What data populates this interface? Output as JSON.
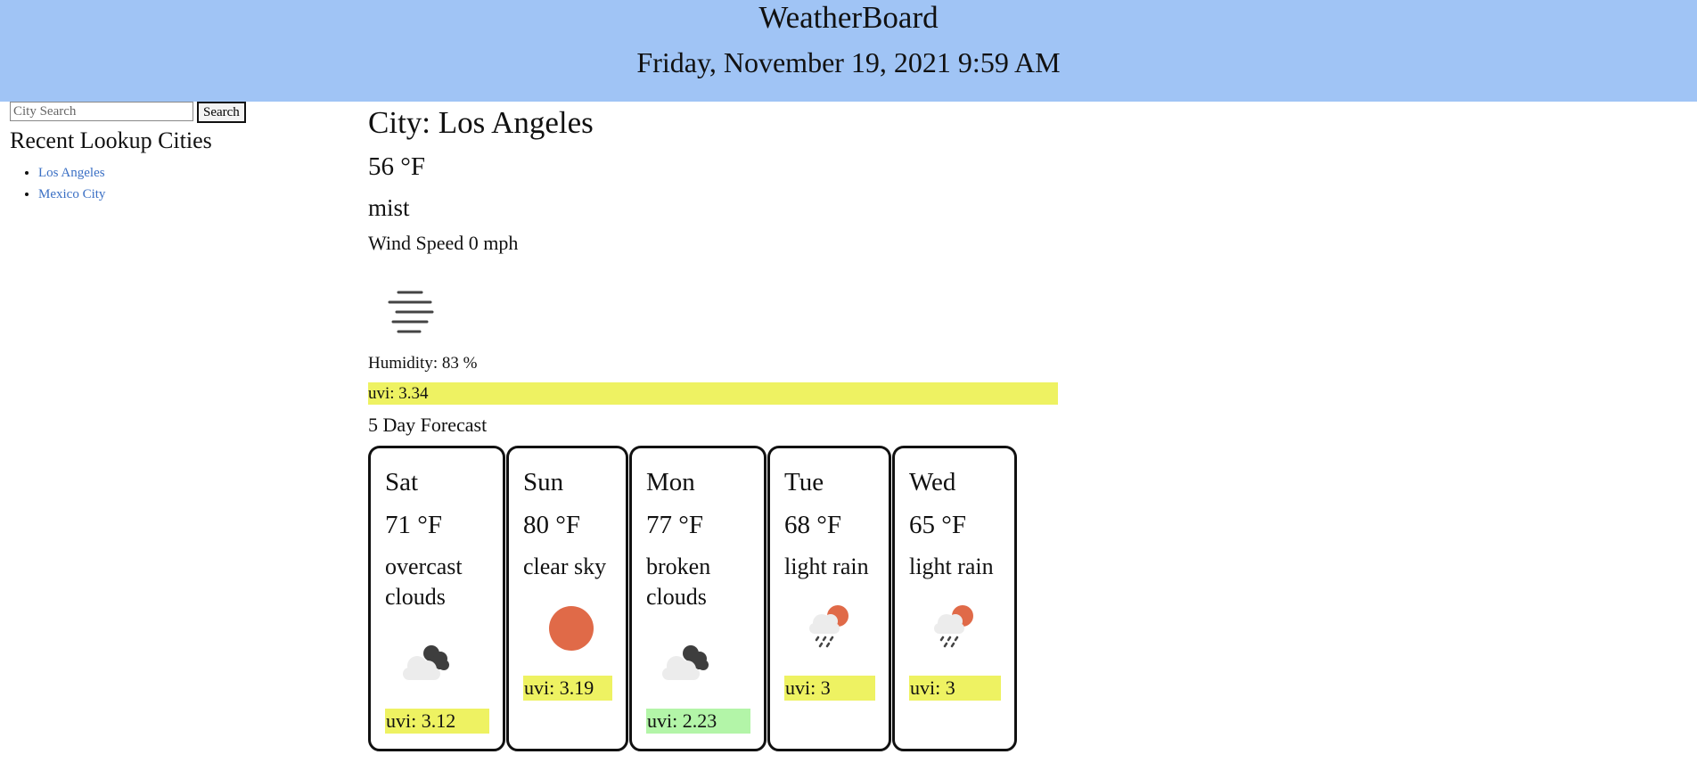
{
  "header": {
    "title": "WeatherBoard",
    "datetime": "Friday, November 19, 2021 9:59 AM",
    "background_color": "#a0c4f5"
  },
  "sidebar": {
    "search": {
      "placeholder": "City Search",
      "value": ""
    },
    "search_button_label": "Search",
    "recent_title": "Recent Lookup Cities",
    "recent_cities": [
      "Los Angeles",
      "Mexico City"
    ],
    "link_color": "#3a6fc4"
  },
  "current": {
    "city": "City: Los Angeles",
    "temp": "56 °F",
    "description": "mist",
    "wind": "Wind Speed 0 mph",
    "icon": "mist-icon",
    "humidity": "Humidity: 83 %",
    "uvi": "uvi: 3.34",
    "uvi_color": "#eef262"
  },
  "forecast": {
    "title": "5 Day Forecast",
    "days": [
      {
        "day": "Sat",
        "temp": "71 °F",
        "description": "overcast clouds",
        "icon": "overcast-clouds-icon",
        "uvi": "uvi: 3.12",
        "uvi_color": "#eef262"
      },
      {
        "day": "Sun",
        "temp": "80 °F",
        "description": "clear sky",
        "icon": "sun-icon",
        "uvi": "uvi: 3.19",
        "uvi_color": "#eef262"
      },
      {
        "day": "Mon",
        "temp": "77 °F",
        "description": "broken clouds",
        "icon": "broken-clouds-icon",
        "uvi": "uvi: 2.23",
        "uvi_color": "#b3f5a8"
      },
      {
        "day": "Tue",
        "temp": "68 °F",
        "description": "light rain",
        "icon": "light-rain-icon",
        "uvi": "uvi: 3",
        "uvi_color": "#eef262"
      },
      {
        "day": "Wed",
        "temp": "65 °F",
        "description": "light rain",
        "icon": "light-rain-icon",
        "uvi": "uvi: 3",
        "uvi_color": "#eef262"
      }
    ]
  }
}
